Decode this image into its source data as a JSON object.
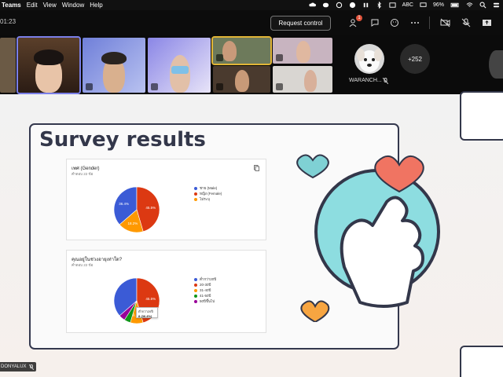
{
  "menubar": {
    "app": "Teams",
    "items": [
      "Edit",
      "View",
      "Window",
      "Help"
    ],
    "status": {
      "keyboard": "ABC",
      "battery": "96%"
    }
  },
  "toolbar": {
    "timer": "01:23",
    "request_control": "Request control",
    "badge_count": "1"
  },
  "participants": {
    "named_tile_label": "WARANCH...",
    "more_count": "+252",
    "bottom_label": "DONYALUX"
  },
  "slide": {
    "title": "Survey results",
    "card1": {
      "title": "เพศ (Gender)",
      "subtitle": "คำตอบ 22 ข้อ",
      "legend": [
        "ชาย (Male)",
        "หญิง (Female)",
        "ไม่ระบุ"
      ],
      "slice_labels": [
        "45.5%",
        "36.4%",
        "18.2%"
      ]
    },
    "card2": {
      "title": "คุณอยู่ในช่วงอายุเท่าใด?",
      "subtitle": "คำตอบ 22 ข้อ",
      "legend": [
        "ต่ำกว่า20ปี",
        "20-30ปี",
        "31-40ปี",
        "41-50ปี",
        "50ปีขึ้นไป"
      ],
      "slice_labels": [
        "45.5%",
        "9.1%"
      ],
      "tooltip_label": "ต่ำกว่า20ปี",
      "tooltip_value": "8 (36.4%)"
    }
  },
  "colors": {
    "blue": "#3b5bd6",
    "red": "#dc3912",
    "orange": "#ff9900",
    "green": "#109618",
    "purple": "#990099",
    "teal": "#8ddde0",
    "heart_red": "#f07462",
    "heart_orange": "#f7a541",
    "heart_teal": "#7fd1d4"
  },
  "chart_data": [
    {
      "type": "pie",
      "title": "เพศ (Gender)",
      "categories": [
        "ชาย (Male)",
        "หญิง (Female)",
        "ไม่ระบุ"
      ],
      "values": [
        36.4,
        45.5,
        18.2
      ]
    },
    {
      "type": "pie",
      "title": "คุณอยู่ในช่วงอายุเท่าใด?",
      "categories": [
        "ต่ำกว่า20ปี",
        "20-30ปี",
        "31-40ปี",
        "41-50ปี",
        "50ปีขึ้นไป"
      ],
      "values": [
        36.4,
        45.5,
        9.1,
        4.5,
        4.5
      ]
    }
  ]
}
